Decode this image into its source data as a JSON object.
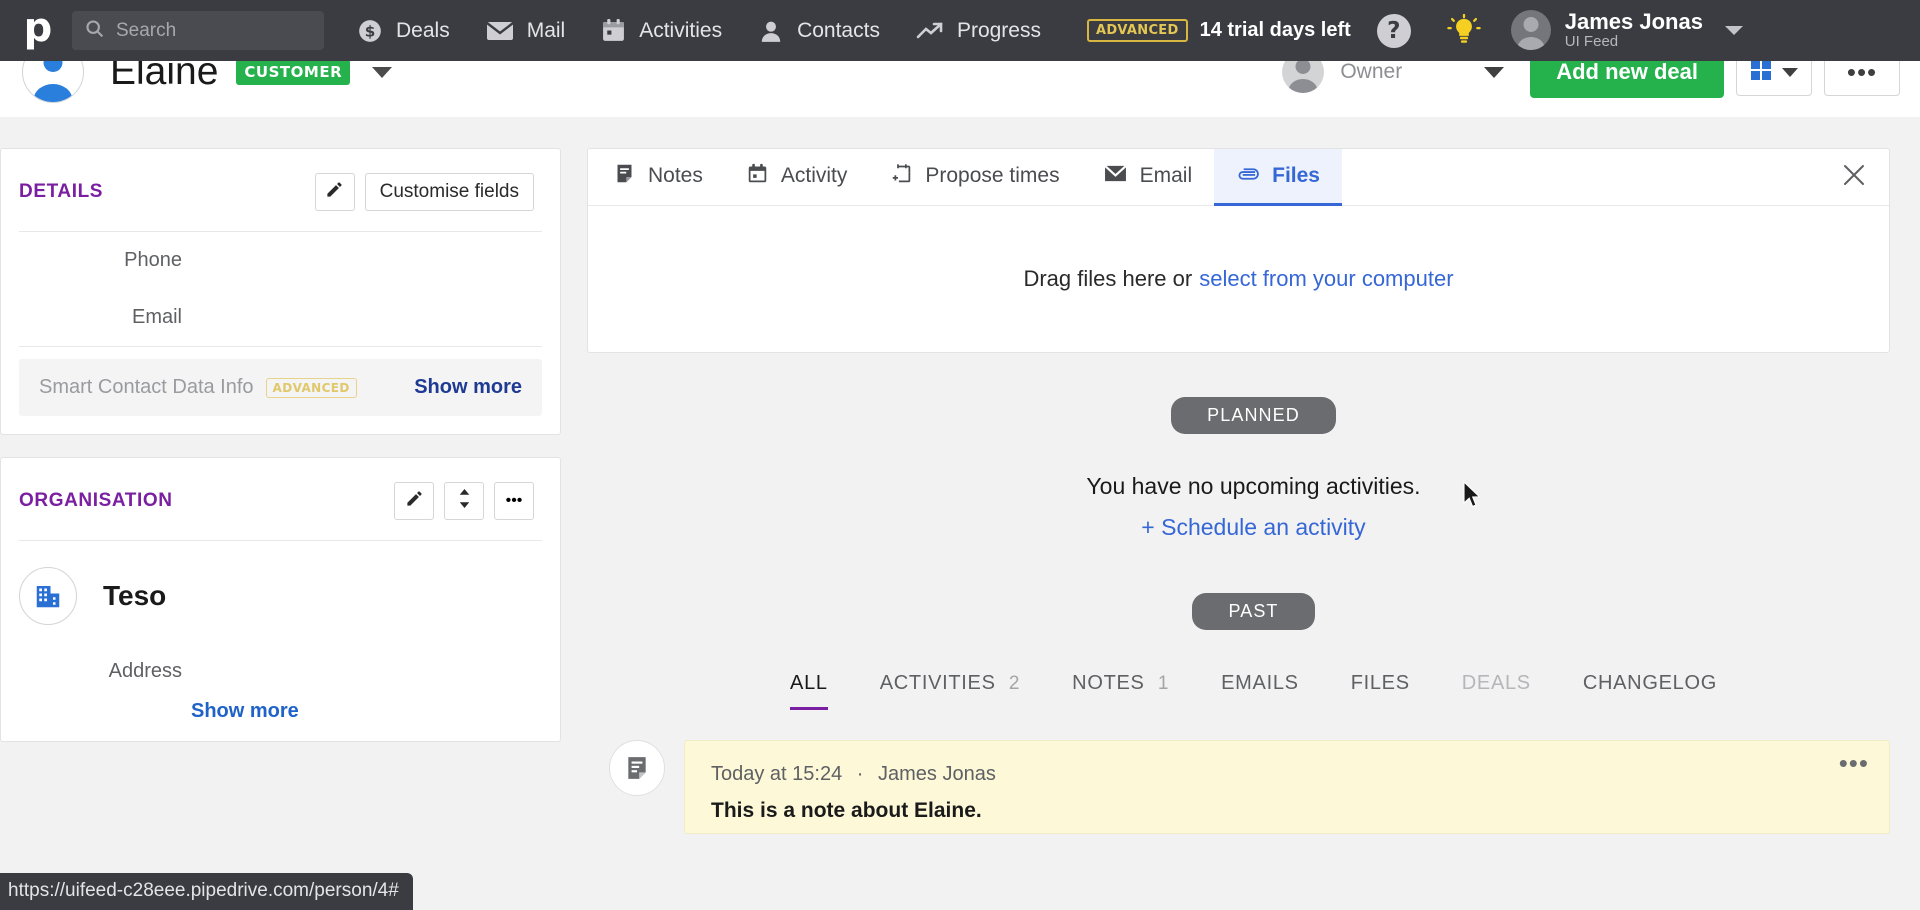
{
  "topnav": {
    "logo": "p",
    "search": {
      "placeholder": "Search",
      "icon": "search-icon"
    },
    "items": [
      {
        "label": "Deals",
        "icon": "dollar-circle-icon"
      },
      {
        "label": "Mail",
        "icon": "envelope-icon"
      },
      {
        "label": "Activities",
        "icon": "calendar-icon"
      },
      {
        "label": "Contacts",
        "icon": "person-icon"
      },
      {
        "label": "Progress",
        "icon": "trending-up-icon"
      }
    ],
    "trial": {
      "badge": "ADVANCED",
      "text": "14 trial days left",
      "badge_color": "#e3c754"
    },
    "help": "?",
    "bulb_icon": "lightbulb-icon",
    "user": {
      "name": "James Jonas",
      "subtitle": "UI Feed"
    }
  },
  "person_header": {
    "name": "Elaine",
    "badge": "CUSTOMER",
    "badge_color": "#25b14c",
    "owner_label": "Owner",
    "add_deal_label": "Add new deal",
    "more_dots": "•••"
  },
  "sidebar": {
    "details": {
      "title": "DETAILS",
      "customise_label": "Customise fields",
      "fields": [
        {
          "label": "Phone",
          "value": ""
        },
        {
          "label": "Email",
          "value": ""
        }
      ],
      "smart": {
        "label": "Smart Contact Data Info",
        "badge": "ADVANCED",
        "show_more": "Show more"
      }
    },
    "organisation": {
      "title": "ORGANISATION",
      "name": "Teso",
      "fields": [
        {
          "label": "Address",
          "value": ""
        }
      ],
      "show_more": "Show more"
    }
  },
  "main": {
    "compose_tabs": [
      {
        "label": "Notes",
        "icon": "note-icon",
        "active": false
      },
      {
        "label": "Activity",
        "icon": "calendar-icon",
        "active": false
      },
      {
        "label": "Propose times",
        "icon": "calendar-plus-icon",
        "active": false
      },
      {
        "label": "Email",
        "icon": "envelope-icon",
        "active": false
      },
      {
        "label": "Files",
        "icon": "paperclip-icon",
        "active": true
      }
    ],
    "dropzone": {
      "text": "Drag files here or",
      "link": "select from your computer"
    },
    "planned": {
      "pill": "PLANNED",
      "empty_text": "You have no upcoming activities.",
      "schedule_link": "+ Schedule an activity"
    },
    "past": {
      "pill": "PAST"
    },
    "filter_tabs": [
      {
        "label": "ALL",
        "count": "",
        "active": true,
        "disabled": false
      },
      {
        "label": "ACTIVITIES",
        "count": "2",
        "active": false,
        "disabled": false
      },
      {
        "label": "NOTES",
        "count": "1",
        "active": false,
        "disabled": false
      },
      {
        "label": "EMAILS",
        "count": "",
        "active": false,
        "disabled": false
      },
      {
        "label": "FILES",
        "count": "",
        "active": false,
        "disabled": false
      },
      {
        "label": "DEALS",
        "count": "",
        "active": false,
        "disabled": true
      },
      {
        "label": "CHANGELOG",
        "count": "",
        "active": false,
        "disabled": false
      }
    ],
    "note": {
      "time": "Today at 15:24",
      "separator": "·",
      "author": "James Jonas",
      "body": "This is a note about Elaine.",
      "dots": "•••"
    }
  },
  "statusbar": {
    "url": "https://uifeed-c28eee.pipedrive.com/person/4#"
  }
}
